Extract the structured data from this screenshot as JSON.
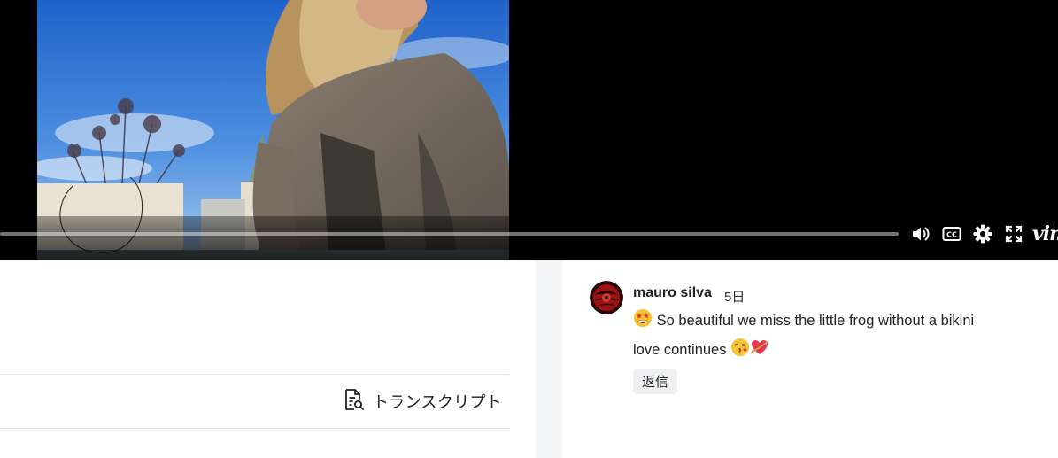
{
  "player": {
    "progress": 0.0,
    "brand": "vim",
    "controls": [
      "volume-icon",
      "closed-captions-icon",
      "settings-gear-icon",
      "fullscreen-icon"
    ]
  },
  "transcript": {
    "label": "トランスクリプト",
    "icon": "transcript-document-search-icon"
  },
  "comment": {
    "author": "mauro silva",
    "time": "5日",
    "text_line1": "So beautiful  we miss the little frog without a bikini",
    "text_line2": "love continues",
    "leading_emoji": "star-struck-emoji",
    "trailing_emojis": [
      "winking-kiss-emoji",
      "heart-with-arrow-emoji"
    ],
    "reply_label": "返信"
  },
  "colors": {
    "player_bg": "#000000",
    "gutter": "#f4f5f6",
    "reply_bg": "#eef0f2",
    "divider": "#e3e3e3"
  }
}
